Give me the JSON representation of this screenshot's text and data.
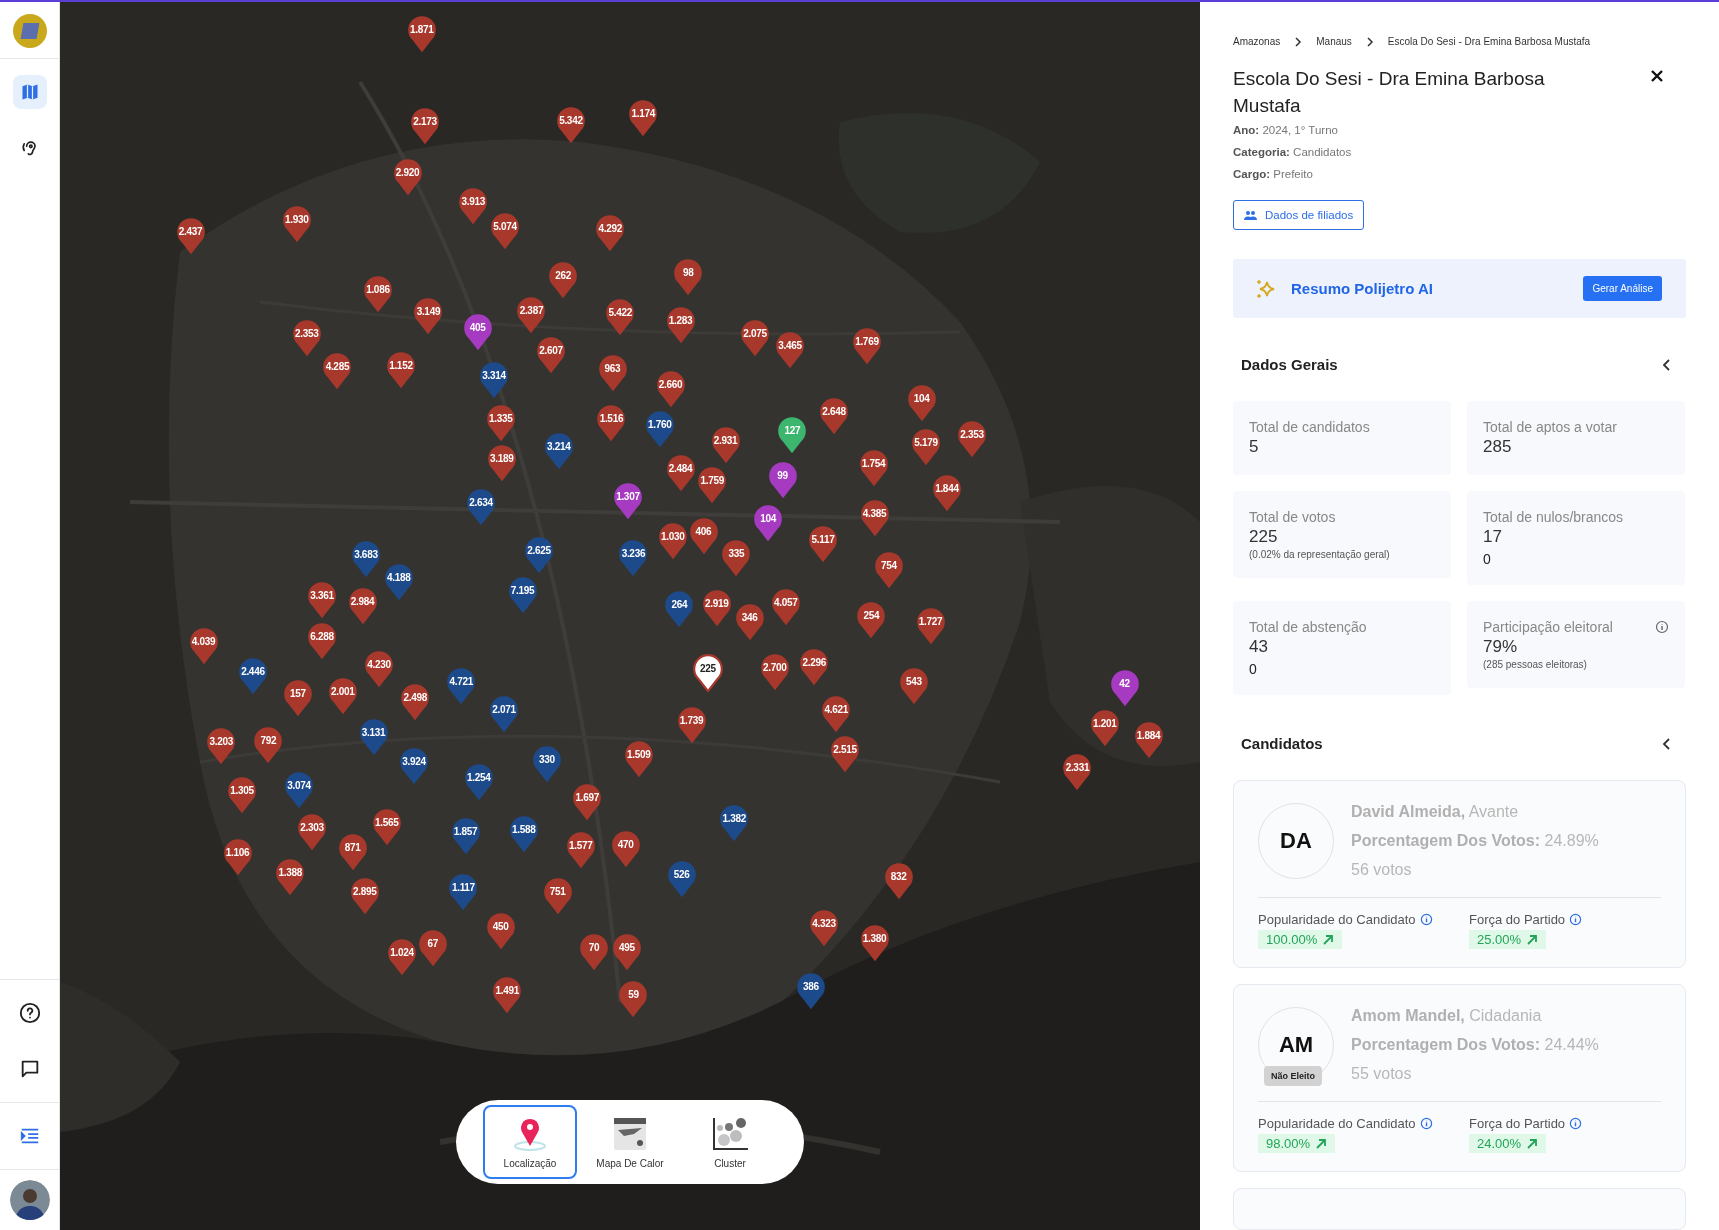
{
  "sidebar": {
    "nav": [
      {
        "selected": true
      },
      {
        "selected": false
      }
    ]
  },
  "map": {
    "pins": [
      {
        "label": "1.871",
        "color": "#a8382b",
        "selected": false
      },
      {
        "label": "2.173",
        "color": "#a8382b",
        "selected": false
      },
      {
        "label": "5.342",
        "color": "#a8382b",
        "selected": false
      },
      {
        "label": "1.174",
        "color": "#a8382b",
        "selected": false
      },
      {
        "label": "2.920",
        "color": "#a8382b",
        "selected": false
      },
      {
        "label": "3.913",
        "color": "#a8382b",
        "selected": false
      },
      {
        "label": "2.437",
        "color": "#a8382b",
        "selected": false
      },
      {
        "label": "1.930",
        "color": "#a8382b",
        "selected": false
      },
      {
        "label": "5.074",
        "color": "#a8382b",
        "selected": false
      },
      {
        "label": "4.292",
        "color": "#a8382b",
        "selected": false
      },
      {
        "label": "262",
        "color": "#a8382b",
        "selected": false
      },
      {
        "label": "98",
        "color": "#a8382b",
        "selected": false
      },
      {
        "label": "1.086",
        "color": "#a8382b",
        "selected": false
      },
      {
        "label": "2.353",
        "color": "#a8382b",
        "selected": false
      },
      {
        "label": "3.149",
        "color": "#a8382b",
        "selected": false
      },
      {
        "label": "405",
        "color": "#a63bc2",
        "selected": false
      },
      {
        "label": "2.387",
        "color": "#a8382b",
        "selected": false
      },
      {
        "label": "2.607",
        "color": "#a8382b",
        "selected": false
      },
      {
        "label": "5.422",
        "color": "#a8382b",
        "selected": false
      },
      {
        "label": "1.283",
        "color": "#a8382b",
        "selected": false
      },
      {
        "label": "2.075",
        "color": "#a8382b",
        "selected": false
      },
      {
        "label": "3.465",
        "color": "#a8382b",
        "selected": false
      },
      {
        "label": "1.769",
        "color": "#a8382b",
        "selected": false
      },
      {
        "label": "4.285",
        "color": "#a8382b",
        "selected": false
      },
      {
        "label": "1.152",
        "color": "#a8382b",
        "selected": false
      },
      {
        "label": "3.314",
        "color": "#1d4a8a",
        "selected": false
      },
      {
        "label": "963",
        "color": "#a8382b",
        "selected": false
      },
      {
        "label": "2.660",
        "color": "#a8382b",
        "selected": false
      },
      {
        "label": "104",
        "color": "#a8382b",
        "selected": false
      },
      {
        "label": "1.335",
        "color": "#a8382b",
        "selected": false
      },
      {
        "label": "3.214",
        "color": "#1d4a8a",
        "selected": false
      },
      {
        "label": "1.516",
        "color": "#a8382b",
        "selected": false
      },
      {
        "label": "1.760",
        "color": "#1d4a8a",
        "selected": false
      },
      {
        "label": "2.931",
        "color": "#a8382b",
        "selected": false
      },
      {
        "label": "127",
        "color": "#3cb66e",
        "selected": false
      },
      {
        "label": "2.648",
        "color": "#a8382b",
        "selected": false
      },
      {
        "label": "5.179",
        "color": "#a8382b",
        "selected": false
      },
      {
        "label": "2.353",
        "color": "#a8382b",
        "selected": false
      },
      {
        "label": "2.634",
        "color": "#1d4a8a",
        "selected": false
      },
      {
        "label": "3.189",
        "color": "#a8382b",
        "selected": false
      },
      {
        "label": "1.307",
        "color": "#a63bc2",
        "selected": false
      },
      {
        "label": "2.484",
        "color": "#a8382b",
        "selected": false
      },
      {
        "label": "1.759",
        "color": "#a8382b",
        "selected": false
      },
      {
        "label": "104",
        "color": "#a63bc2",
        "selected": false
      },
      {
        "label": "99",
        "color": "#a63bc2",
        "selected": false
      },
      {
        "label": "1.754",
        "color": "#a8382b",
        "selected": false
      },
      {
        "label": "4.385",
        "color": "#a8382b",
        "selected": false
      },
      {
        "label": "1.844",
        "color": "#a8382b",
        "selected": false
      },
      {
        "label": "3.683",
        "color": "#1d4a8a",
        "selected": false
      },
      {
        "label": "2.625",
        "color": "#1d4a8a",
        "selected": false
      },
      {
        "label": "3.236",
        "color": "#1d4a8a",
        "selected": false
      },
      {
        "label": "1.030",
        "color": "#a8382b",
        "selected": false
      },
      {
        "label": "406",
        "color": "#a8382b",
        "selected": false
      },
      {
        "label": "335",
        "color": "#a8382b",
        "selected": false
      },
      {
        "label": "5.117",
        "color": "#a8382b",
        "selected": false
      },
      {
        "label": "754",
        "color": "#a8382b",
        "selected": false
      },
      {
        "label": "4.188",
        "color": "#1d4a8a",
        "selected": false
      },
      {
        "label": "3.361",
        "color": "#a8382b",
        "selected": false
      },
      {
        "label": "2.984",
        "color": "#a8382b",
        "selected": false
      },
      {
        "label": "7.195",
        "color": "#1d4a8a",
        "selected": false
      },
      {
        "label": "264",
        "color": "#1d4a8a",
        "selected": false
      },
      {
        "label": "2.919",
        "color": "#a8382b",
        "selected": false
      },
      {
        "label": "346",
        "color": "#a8382b",
        "selected": false
      },
      {
        "label": "4.057",
        "color": "#a8382b",
        "selected": false
      },
      {
        "label": "254",
        "color": "#a8382b",
        "selected": false
      },
      {
        "label": "1.727",
        "color": "#a8382b",
        "selected": false
      },
      {
        "label": "4.039",
        "color": "#a8382b",
        "selected": false
      },
      {
        "label": "6.288",
        "color": "#a8382b",
        "selected": false
      },
      {
        "label": "2.446",
        "color": "#1d4a8a",
        "selected": false
      },
      {
        "label": "157",
        "color": "#a8382b",
        "selected": false
      },
      {
        "label": "2.001",
        "color": "#a8382b",
        "selected": false
      },
      {
        "label": "4.230",
        "color": "#a8382b",
        "selected": false
      },
      {
        "label": "2.498",
        "color": "#a8382b",
        "selected": false
      },
      {
        "label": "4.721",
        "color": "#1d4a8a",
        "selected": false
      },
      {
        "label": "225",
        "color": "#a8382b",
        "selected": true
      },
      {
        "label": "2.700",
        "color": "#a8382b",
        "selected": false
      },
      {
        "label": "2.296",
        "color": "#a8382b",
        "selected": false
      },
      {
        "label": "543",
        "color": "#a8382b",
        "selected": false
      },
      {
        "label": "42",
        "color": "#a63bc2",
        "selected": false
      },
      {
        "label": "3.203",
        "color": "#a8382b",
        "selected": false
      },
      {
        "label": "1.305",
        "color": "#a8382b",
        "selected": false
      },
      {
        "label": "792",
        "color": "#a8382b",
        "selected": false
      },
      {
        "label": "3.074",
        "color": "#1d4a8a",
        "selected": false
      },
      {
        "label": "3.131",
        "color": "#1d4a8a",
        "selected": false
      },
      {
        "label": "3.924",
        "color": "#1d4a8a",
        "selected": false
      },
      {
        "label": "1.254",
        "color": "#1d4a8a",
        "selected": false
      },
      {
        "label": "2.071",
        "color": "#1d4a8a",
        "selected": false
      },
      {
        "label": "330",
        "color": "#1d4a8a",
        "selected": false
      },
      {
        "label": "1.697",
        "color": "#a8382b",
        "selected": false
      },
      {
        "label": "1.509",
        "color": "#a8382b",
        "selected": false
      },
      {
        "label": "1.739",
        "color": "#a8382b",
        "selected": false
      },
      {
        "label": "4.621",
        "color": "#a8382b",
        "selected": false
      },
      {
        "label": "2.515",
        "color": "#a8382b",
        "selected": false
      },
      {
        "label": "2.331",
        "color": "#a8382b",
        "selected": false
      },
      {
        "label": "1.201",
        "color": "#a8382b",
        "selected": false
      },
      {
        "label": "1.884",
        "color": "#a8382b",
        "selected": false
      },
      {
        "label": "2.303",
        "color": "#a8382b",
        "selected": false
      },
      {
        "label": "1.565",
        "color": "#a8382b",
        "selected": false
      },
      {
        "label": "1.857",
        "color": "#1d4a8a",
        "selected": false
      },
      {
        "label": "1.588",
        "color": "#1d4a8a",
        "selected": false
      },
      {
        "label": "1.382",
        "color": "#1d4a8a",
        "selected": false
      },
      {
        "label": "1.106",
        "color": "#a8382b",
        "selected": false
      },
      {
        "label": "871",
        "color": "#a8382b",
        "selected": false
      },
      {
        "label": "1.577",
        "color": "#a8382b",
        "selected": false
      },
      {
        "label": "470",
        "color": "#a8382b",
        "selected": false
      },
      {
        "label": "1.388",
        "color": "#a8382b",
        "selected": false
      },
      {
        "label": "2.895",
        "color": "#a8382b",
        "selected": false
      },
      {
        "label": "1.117",
        "color": "#1d4a8a",
        "selected": false
      },
      {
        "label": "751",
        "color": "#a8382b",
        "selected": false
      },
      {
        "label": "526",
        "color": "#1d4a8a",
        "selected": false
      },
      {
        "label": "832",
        "color": "#a8382b",
        "selected": false
      },
      {
        "label": "450",
        "color": "#a8382b",
        "selected": false
      },
      {
        "label": "4.323",
        "color": "#a8382b",
        "selected": false
      },
      {
        "label": "1.024",
        "color": "#a8382b",
        "selected": false
      },
      {
        "label": "67",
        "color": "#a8382b",
        "selected": false
      },
      {
        "label": "70",
        "color": "#a8382b",
        "selected": false
      },
      {
        "label": "495",
        "color": "#a8382b",
        "selected": false
      },
      {
        "label": "1.380",
        "color": "#a8382b",
        "selected": false
      },
      {
        "label": "1.491",
        "color": "#a8382b",
        "selected": false
      },
      {
        "label": "59",
        "color": "#a8382b",
        "selected": false
      },
      {
        "label": "386",
        "color": "#1d4a8a",
        "selected": false
      }
    ],
    "modes": [
      {
        "label": "Localização",
        "selected": true
      },
      {
        "label": "Mapa De Calor",
        "selected": false
      },
      {
        "label": "Cluster",
        "selected": false
      }
    ]
  },
  "panel": {
    "breadcrumb": [
      "Amazonas",
      "Manaus",
      "Escola Do Sesi - Dra Emina Barbosa Mustafa"
    ],
    "title": "Escola Do Sesi - Dra Emina Barbosa Mustafa",
    "meta": [
      "**Ano:** 2024, 1° Turno",
      "**Categoria:** Candidatos",
      "**Cargo:** Prefeito"
    ],
    "members_button": "Dados de filiados",
    "ai": {
      "title": "Resumo Polijetro AI",
      "button": "Gerar Análise"
    },
    "general": {
      "title": "Dados Gerais",
      "stats": [
        {
          "label": "Total de candidatos",
          "value": "5",
          "info": false
        },
        {
          "label": "Total de aptos a votar",
          "value": "285",
          "info": false
        },
        {
          "label": "Total de votos",
          "value": "225",
          "note": "(0.02% da representação geral)",
          "info": false
        },
        {
          "label": "Total de nulos/brancos",
          "value": "17",
          "extra": "0",
          "info": false
        },
        {
          "label": "Total de abstenção",
          "value": "43",
          "extra": "0",
          "info": false
        },
        {
          "label": "Participação eleitoral",
          "value": "79%",
          "note": "(285 pessoas eleitoras)",
          "info": true
        }
      ]
    },
    "candidates": {
      "title": "Candidatos",
      "items": [
        {
          "initials": "DA",
          "name": "**David Almeida,** Avante",
          "share": "**Porcentagem Dos Votos:** 24.89%",
          "votes": "56 votos",
          "metrics": [
            {
              "label": "Popularidade do Candidato",
              "value": "100.00%"
            },
            {
              "label": "Força do Partido",
              "value": "25.00%"
            }
          ]
        },
        {
          "initials": "AM",
          "badge": "Não Eleito",
          "name": "**Amom Mandel,** Cidadania",
          "share": "**Porcentagem Dos Votos:** 24.44%",
          "votes": "55 votos",
          "metrics": [
            {
              "label": "Popularidade do Candidato",
              "value": "98.00%"
            },
            {
              "label": "Força do Partido",
              "value": "24.00%"
            }
          ]
        }
      ]
    }
  }
}
